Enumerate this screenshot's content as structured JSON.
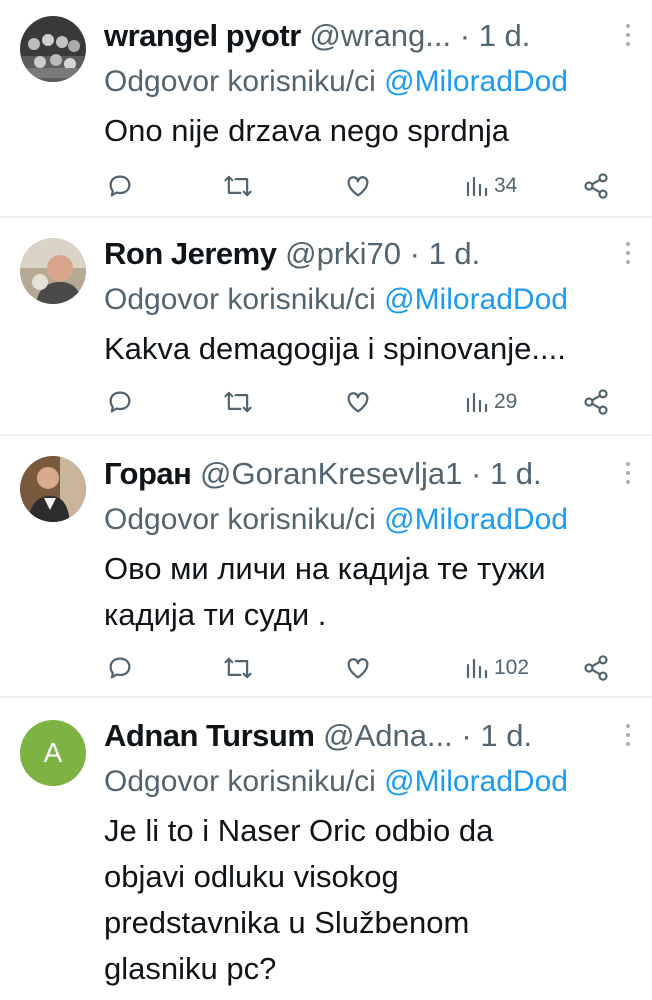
{
  "tweets": [
    {
      "name": "wrangel pyotr",
      "handle": "@wrang...",
      "sep": " · ",
      "time": "1 d.",
      "reply_prefix": "Odgovor korisniku/ci ",
      "reply_mention": "@MiloradDod",
      "lines": [
        "Ono nije drzava nego sprdnja"
      ],
      "views": "34",
      "avatar": "photo-group"
    },
    {
      "name": "Ron Jeremy",
      "handle": "@prki70",
      "sep": " · ",
      "time": "1 d.",
      "reply_prefix": "Odgovor korisniku/ci ",
      "reply_mention": "@MiloradDod",
      "lines": [
        "Kakva demagogija i spinovanje...."
      ],
      "views": "29",
      "avatar": "photo-man"
    },
    {
      "name": "Горан",
      "handle": "@GoranKresevlja1",
      "sep": " · ",
      "time": "1 d.",
      "reply_prefix": "Odgovor korisniku/ci ",
      "reply_mention": "@MiloradDod",
      "lines": [
        "Ово ми личи на кадија те тужи",
        "кадија ти суди ."
      ],
      "views": "102",
      "avatar": "photo-man-suit"
    },
    {
      "name": "Adnan Tursum",
      "handle": "@Adna...",
      "sep": " · ",
      "time": "1 d.",
      "reply_prefix": "Odgovor korisniku/ci ",
      "reply_mention": "@MiloradDod",
      "lines": [
        "Je li to i Naser Oric odbio da",
        "objavi odluku visokog",
        "predstavnika u Službenom",
        "glasniku pc?"
      ],
      "avatar_letter": "A",
      "avatar_color": "#7cb342"
    }
  ],
  "icons": [
    "reply-icon",
    "retweet-icon",
    "like-icon",
    "views-icon",
    "share-icon",
    "more-icon"
  ]
}
